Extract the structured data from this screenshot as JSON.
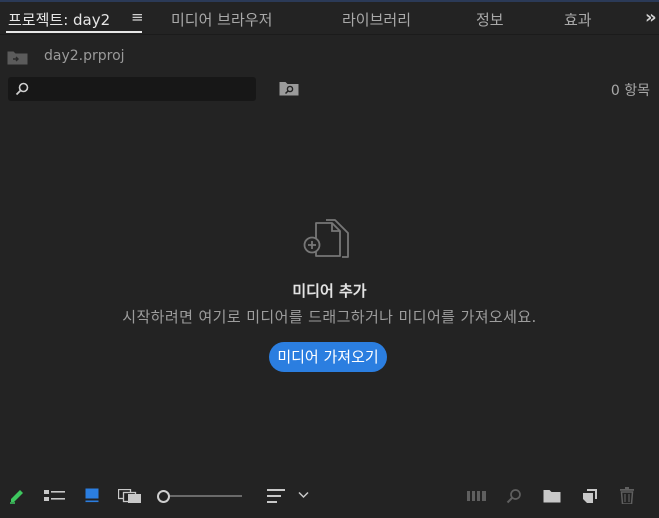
{
  "tabs": {
    "project": "프로젝트: day2",
    "menu_icon": "hamburger-icon",
    "media_browser": "미디어 브라우저",
    "libraries": "라이브러리",
    "info": "정보",
    "effects": "효과",
    "more": "»"
  },
  "project": {
    "name": "day2.prproj"
  },
  "search": {
    "value": "",
    "placeholder": ""
  },
  "item_count": "0 항목",
  "empty_state": {
    "title": "미디어 추가",
    "description": "시작하려면 여기로 미디어를 드래그하거나 미디어를 가져오세요.",
    "button": "미디어 가져오기"
  },
  "zoom_slider": {
    "value": 0.0
  },
  "colors": {
    "background": "#232323",
    "accent": "#2b7ee0",
    "pencil": "#3ec75f",
    "icon_view_active": "#2b7ee0"
  }
}
